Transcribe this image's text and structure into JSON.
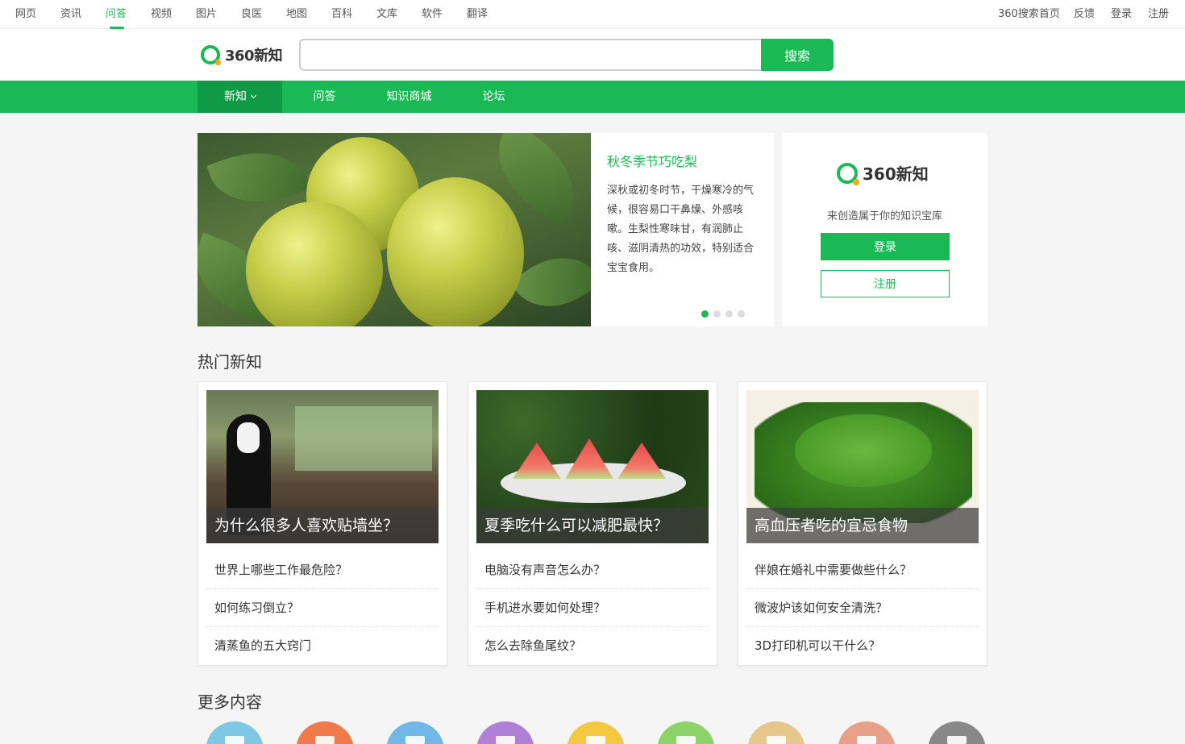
{
  "topnav": {
    "items": [
      "网页",
      "资讯",
      "问答",
      "视频",
      "图片",
      "良医",
      "地图",
      "百科",
      "文库",
      "软件",
      "翻译"
    ],
    "active_index": 2,
    "right": [
      "360搜索首页",
      "反馈",
      "登录",
      "注册"
    ]
  },
  "header": {
    "logo_text": "360新知",
    "search_placeholder": "",
    "search_button": "搜索"
  },
  "greennav": {
    "items": [
      "新知",
      "问答",
      "知识商城",
      "论坛"
    ],
    "active_index": 0
  },
  "carousel": {
    "title": "秋冬季节巧吃梨",
    "description": "深秋或初冬时节，干燥寒冷的气候，很容易口干鼻燥、外感咳嗽。生梨性寒味甘，有润肺止咳、滋阴清热的功效，特别适合宝宝食用。",
    "slide_count": 4,
    "active_slide": 0
  },
  "login_card": {
    "logo_text": "360新知",
    "subtitle": "来创造属于你的知识宝库",
    "login_button": "登录",
    "register_button": "注册"
  },
  "hot_section": {
    "title": "热门新知",
    "cards": [
      {
        "caption": "为什么很多人喜欢贴墙坐？",
        "questions": [
          "世界上哪些工作最危险？",
          "如何练习倒立？",
          "清蒸鱼的五大窍门"
        ]
      },
      {
        "caption": "夏季吃什么可以减肥最快？",
        "questions": [
          "电脑没有声音怎么办？",
          "手机进水要如何处理？",
          "怎么去除鱼尾纹？"
        ]
      },
      {
        "caption": "高血压者吃的宜忌食物",
        "questions": [
          "伴娘在婚礼中需要做些什么？",
          "微波炉该如何安全清洗？",
          "3D打印机可以干什么？"
        ]
      }
    ]
  },
  "more_section": {
    "title": "更多内容",
    "icon_colors": [
      "#7ec8e3",
      "#f07a4a",
      "#6fb8e8",
      "#b07fd6",
      "#f5c842",
      "#8dd468",
      "#e6c88a",
      "#e8a08a",
      "#888888"
    ]
  }
}
